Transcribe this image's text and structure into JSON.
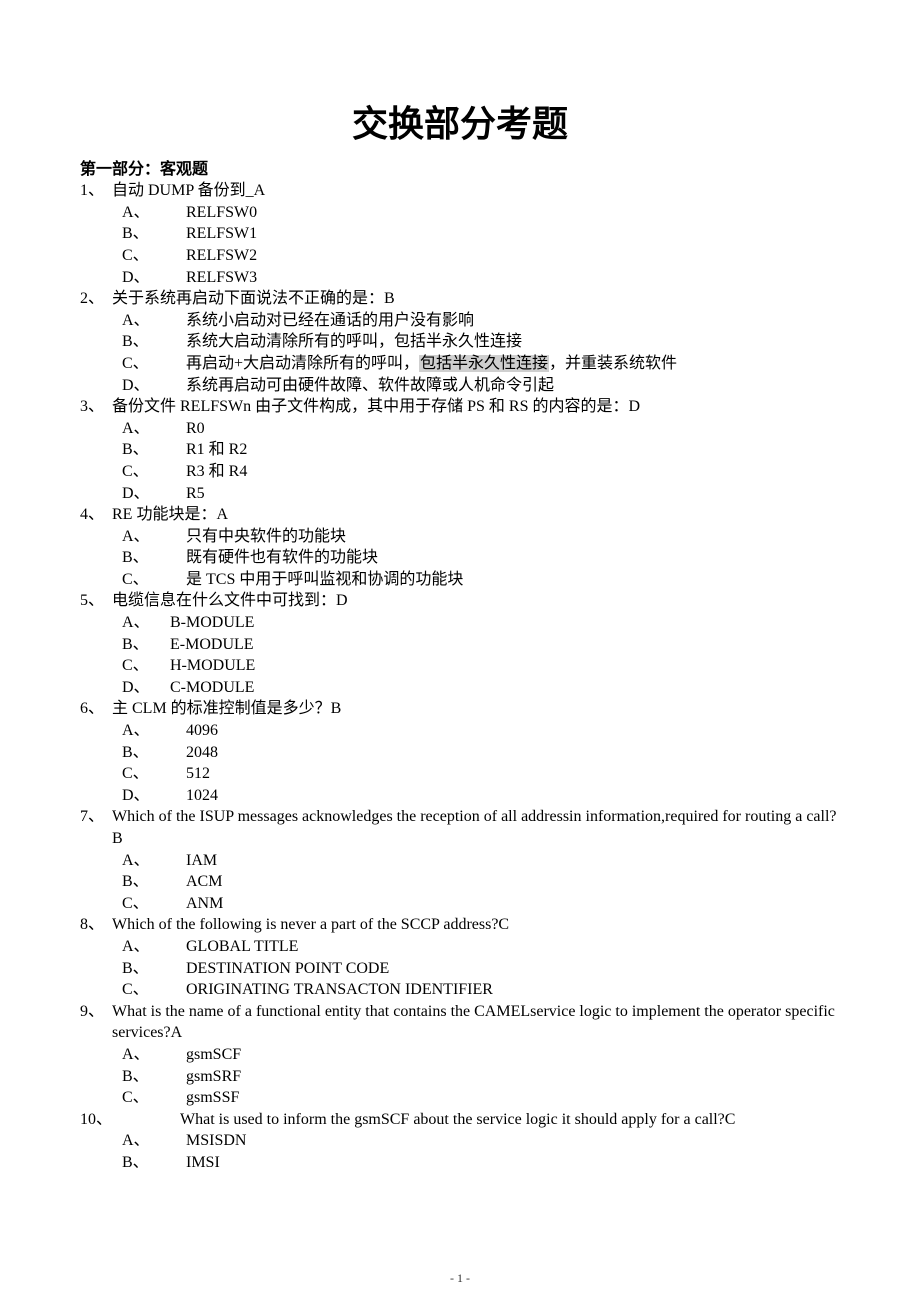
{
  "title": "交换部分考题",
  "section1_heading": "第一部分：客观题",
  "page_number": "- 1 -",
  "sep": "、",
  "questions": [
    {
      "num": "1",
      "stem": "自动 DUMP 备份到_A",
      "options": [
        {
          "l": "A",
          "t": "RELFSW0"
        },
        {
          "l": "B",
          "t": "RELFSW1"
        },
        {
          "l": "C",
          "t": "RELFSW2"
        },
        {
          "l": "D",
          "t": "RELFSW3"
        }
      ]
    },
    {
      "num": "2",
      "stem": "关于系统再启动下面说法不正确的是：B",
      "options": [
        {
          "l": "A",
          "t": "系统小启动对已经在通话的用户没有影响"
        },
        {
          "l": "B",
          "t": "系统大启动清除所有的呼叫，包括半永久性连接"
        },
        {
          "l": "C",
          "t_pre": "再启动+大启动清除所有的呼叫，",
          "hl": "包括半永久性连接",
          "t_post": "，并重装系统软件"
        },
        {
          "l": "D",
          "t": "系统再启动可由硬件故障、软件故障或人机命令引起"
        }
      ]
    },
    {
      "num": "3",
      "stem": "备份文件 RELFSWn 由子文件构成，其中用于存储 PS 和 RS 的内容的是：D",
      "options": [
        {
          "l": "A",
          "t": "R0"
        },
        {
          "l": "B",
          "t": "R1 和 R2"
        },
        {
          "l": "C",
          "t": "R3 和 R4"
        },
        {
          "l": "D",
          "t": "R5"
        }
      ]
    },
    {
      "num": "4",
      "stem": "RE 功能块是：A",
      "options": [
        {
          "l": "A",
          "t": "只有中央软件的功能块"
        },
        {
          "l": "B",
          "t": "既有硬件也有软件的功能块"
        },
        {
          "l": "C",
          "t": "是 TCS 中用于呼叫监视和协调的功能块"
        }
      ]
    },
    {
      "num": "5",
      "stem": "电缆信息在什么文件中可找到：D",
      "opt_style": "wide",
      "options": [
        {
          "l": "A",
          "t": "B-MODULE"
        },
        {
          "l": "B",
          "t": "E-MODULE"
        },
        {
          "l": "C",
          "t": "H-MODULE"
        },
        {
          "l": "D",
          "t": "C-MODULE"
        }
      ]
    },
    {
      "num": "6",
      "stem": "主 CLM 的标准控制值是多少？B",
      "options": [
        {
          "l": "A",
          "t": "4096"
        },
        {
          "l": "B",
          "t": "2048"
        },
        {
          "l": "C",
          "t": "512"
        },
        {
          "l": "D",
          "t": "1024"
        }
      ]
    },
    {
      "num": "7",
      "stem": "Which of the ISUP messages acknowledges the reception of all addressin information,required for routing a call?B",
      "options": [
        {
          "l": "A",
          "t": "IAM"
        },
        {
          "l": "B",
          "t": "ACM"
        },
        {
          "l": "C",
          "t": "ANM"
        }
      ]
    },
    {
      "num": "8",
      "stem": "Which of the following is never a part of the SCCP address?C",
      "options": [
        {
          "l": "A",
          "t": "GLOBAL TITLE"
        },
        {
          "l": "B",
          "t": "DESTINATION POINT CODE"
        },
        {
          "l": "C",
          "t": "ORIGINATING TRANSACTON IDENTIFIER"
        }
      ]
    },
    {
      "num": "9",
      "stem": "What is the name of a functional entity that contains the CAMELservice logic to implement the operator specific services?A",
      "options": [
        {
          "l": "A",
          "t": "gsmSCF"
        },
        {
          "l": "B",
          "t": "gsmSRF"
        },
        {
          "l": "C",
          "t": "gsmSSF"
        }
      ]
    },
    {
      "num": "10",
      "stem": "What is used to inform the gsmSCF about the service logic it should apply for a call?C",
      "num_wide": true,
      "options": [
        {
          "l": "A",
          "t": "MSISDN"
        },
        {
          "l": "B",
          "t": "IMSI"
        }
      ]
    }
  ]
}
